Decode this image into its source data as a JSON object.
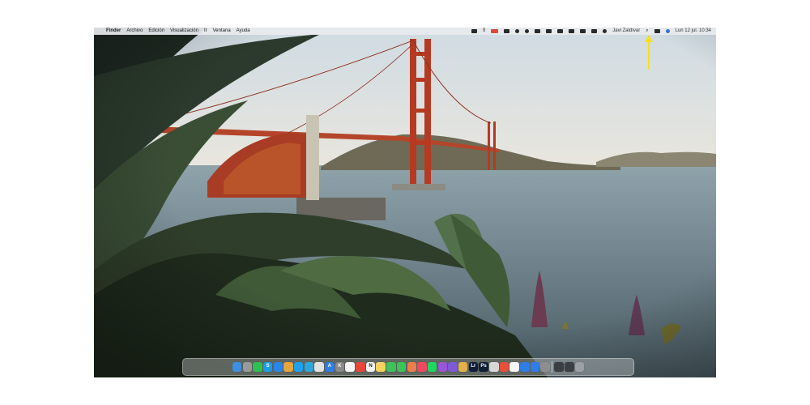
{
  "menubar": {
    "apple_glyph": "",
    "app_name": "Finder",
    "menus": [
      "Archivo",
      "Edición",
      "Visualización",
      "Ir",
      "Ventana",
      "Ayuda"
    ],
    "battery_count": "9",
    "user_name": "Javi Zaldívar",
    "search_glyph": "⌕",
    "clock": "Lun 12 jul. 10:34"
  },
  "status_icons": [
    {
      "name": "notification-badge-icon",
      "color": "#2a2a2a"
    },
    {
      "name": "record-icon",
      "color": "#e0493b"
    },
    {
      "name": "screen-mirror-icon",
      "color": "#2a2a2a"
    },
    {
      "name": "eye-icon",
      "color": "#2a2a2a"
    },
    {
      "name": "steering-icon",
      "color": "#2a2a2a"
    },
    {
      "name": "share-icon",
      "color": "#2a2a2a"
    },
    {
      "name": "dropbox-icon",
      "color": "#2a2a2a"
    },
    {
      "name": "upload-icon",
      "color": "#2a2a2a"
    },
    {
      "name": "volume-icon",
      "color": "#2a2a2a"
    },
    {
      "name": "bluetooth-icon",
      "color": "#2a2a2a"
    },
    {
      "name": "battery-icon",
      "color": "#2a2a2a"
    },
    {
      "name": "wifi-icon",
      "color": "#2a2a2a"
    }
  ],
  "status_right_icons": [
    {
      "name": "control-center-icon",
      "color": "#2a2a2a"
    },
    {
      "name": "siri-icon",
      "color": "#3a6fd8"
    }
  ],
  "dock_apps": [
    {
      "name": "finder-icon",
      "color": "#3f8fe0",
      "glyph": ""
    },
    {
      "name": "launchpad-icon",
      "color": "#9a9a9a",
      "glyph": ""
    },
    {
      "name": "whatsapp-icon",
      "color": "#2fbf52",
      "glyph": ""
    },
    {
      "name": "skype-icon",
      "color": "#1d9de6",
      "glyph": "S"
    },
    {
      "name": "safari-icon",
      "color": "#2a86e8",
      "glyph": ""
    },
    {
      "name": "chrome-icon",
      "color": "#e7a63a",
      "glyph": ""
    },
    {
      "name": "twitter-icon",
      "color": "#1da1f2",
      "glyph": ""
    },
    {
      "name": "telegram-icon",
      "color": "#2ea6da",
      "glyph": ""
    },
    {
      "name": "slack-icon",
      "color": "#e2e2e2",
      "glyph": ""
    },
    {
      "name": "appstore-icon",
      "color": "#2f7de6",
      "glyph": "A"
    },
    {
      "name": "contacts-icon",
      "color": "#8a8a8a",
      "glyph": "K"
    },
    {
      "name": "calendar-icon",
      "color": "#f5f5f5",
      "glyph": ""
    },
    {
      "name": "reminders-icon",
      "color": "#e8463b",
      "glyph": ""
    },
    {
      "name": "notion-icon",
      "color": "#f2f2f2",
      "glyph": "N"
    },
    {
      "name": "notes-icon",
      "color": "#f4d35e",
      "glyph": ""
    },
    {
      "name": "messages-icon",
      "color": "#3ec35a",
      "glyph": ""
    },
    {
      "name": "facetime-icon",
      "color": "#3ec35a",
      "glyph": ""
    },
    {
      "name": "photos-icon",
      "color": "#f07c4a",
      "glyph": ""
    },
    {
      "name": "music-icon",
      "color": "#f04860",
      "glyph": ""
    },
    {
      "name": "spotify-icon",
      "color": "#1ed760",
      "glyph": ""
    },
    {
      "name": "podcasts-icon",
      "color": "#9a55d8",
      "glyph": ""
    },
    {
      "name": "imovie-icon",
      "color": "#7e5ad6",
      "glyph": ""
    },
    {
      "name": "preview-icon",
      "color": "#e4b04a",
      "glyph": ""
    },
    {
      "name": "lightroom-icon",
      "color": "#0e1e36",
      "glyph": "Lr"
    },
    {
      "name": "photoshop-icon",
      "color": "#0e1e36",
      "glyph": "Ps"
    },
    {
      "name": "pixelmator-icon",
      "color": "#d8d8d8",
      "glyph": ""
    },
    {
      "name": "affinity-icon",
      "color": "#e8503a",
      "glyph": ""
    },
    {
      "name": "codepoint-icon",
      "color": "#f5f5f5",
      "glyph": ""
    },
    {
      "name": "testflight-icon",
      "color": "#2f7de6",
      "glyph": ""
    },
    {
      "name": "appstore-alt-icon",
      "color": "#2f7de6",
      "glyph": ""
    },
    {
      "name": "system-preferences-icon",
      "color": "#8e8e8e",
      "glyph": ""
    }
  ],
  "dock_right": [
    {
      "name": "downloads-folder-icon",
      "color": "#3b3f44",
      "glyph": ""
    },
    {
      "name": "screenshots-folder-icon",
      "color": "#3b3f44",
      "glyph": ""
    },
    {
      "name": "trash-icon",
      "color": "#9aa0a6",
      "glyph": ""
    }
  ]
}
